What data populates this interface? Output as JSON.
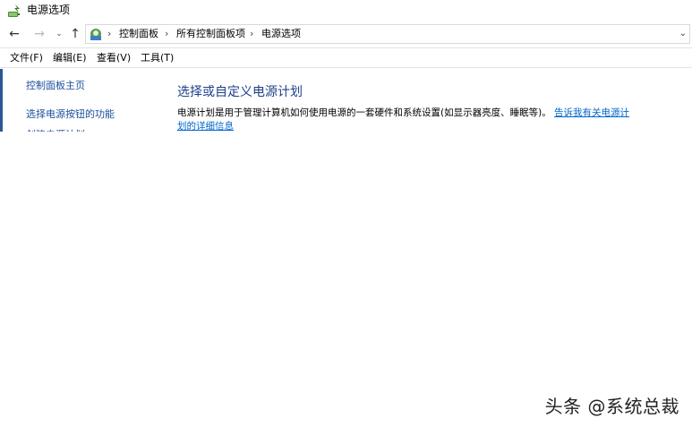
{
  "window": {
    "title": "电源选项",
    "icon": "power-options-icon"
  },
  "navigation": {
    "back_icon": "arrow-left-icon",
    "forward_icon": "arrow-right-icon",
    "recent_icon": "chevron-down-icon",
    "up_icon": "arrow-up-icon"
  },
  "address_bar": {
    "icon": "control-panel-icon",
    "breadcrumbs": [
      "控制面板",
      "所有控制面板项",
      "电源选项"
    ]
  },
  "menu": {
    "items": [
      "文件(F)",
      "编辑(E)",
      "查看(V)",
      "工具(T)"
    ]
  },
  "sidebar": {
    "items": [
      "控制面板主页",
      "选择电源按钮的功能",
      "创建电源计划"
    ],
    "accent_color": "#2b5797"
  },
  "main": {
    "heading": "选择或自定义电源计划",
    "description": "电源计划是用于管理计算机如何使用电源的一套硬件和系统设置(如显示器亮度、睡眠等)。",
    "link": "告诉我有关电源计划的详细信息"
  },
  "watermark": {
    "text": "头条 @系统总裁"
  },
  "colors": {
    "link": "#0066cc",
    "heading": "#1e3f8a",
    "sidebar_link": "#1a4f9c"
  }
}
